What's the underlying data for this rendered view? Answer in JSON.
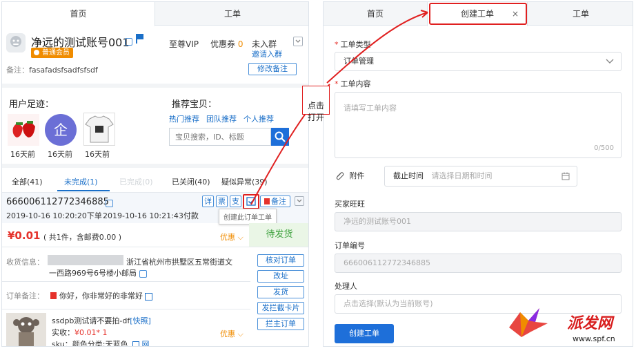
{
  "left": {
    "tabs": [
      "首页",
      "工单"
    ],
    "account": {
      "name": "净远的测试账号001",
      "level_badge": "普通会员",
      "vip": "至尊VIP",
      "coupon_label": "优惠券",
      "coupon_count": "0",
      "group_status": "未入群",
      "invite_link": "邀请入群",
      "note_label": "备注：",
      "note_value": "fasafadsfsadfsfsdf",
      "edit_note_button": "修改备注"
    },
    "footprint": {
      "title": "用户足迹：",
      "items": [
        {
          "time": "16天前",
          "icon": "strawberry-thumbnail"
        },
        {
          "time": "16天前",
          "icon": "enterprise-logo",
          "glyph": "企"
        },
        {
          "time": "16天前",
          "icon": "tshirt-thumbnail"
        }
      ]
    },
    "recommend": {
      "title": "推荐宝贝：",
      "links": [
        "热门推荐",
        "团队推荐",
        "个人推荐"
      ],
      "search_placeholder": "宝贝搜索，ID、标题"
    },
    "order_tabs": [
      "全部(41)",
      "未完成(1)",
      "已完成(0)",
      "已关闭(40)",
      "疑似异常(39)"
    ],
    "order": {
      "id": "666006112772346885",
      "placed_time": "2019-10-16 10:20:20下单",
      "paid_time": "2019-10-16 10:21:43付款",
      "action_buttons": [
        "详",
        "票",
        "支"
      ],
      "note_button": "备注",
      "tooltip": "创建此订单工单",
      "price": "¥0.01",
      "price_detail": "( 共1件，含邮费0.00 )",
      "discount": "优惠",
      "status": "待发货",
      "address_label": "收货信息：",
      "address_line1": "浙江省杭州市拱墅区五常街道文",
      "address_line2": "一西路969号6号楼小邮局",
      "order_note_label": "订单备注：",
      "order_note_value": "你好，你非常好的非常好",
      "side_buttons": [
        "核对订单",
        "改址",
        "发货",
        "发拦截卡片",
        "拦主订单"
      ],
      "product_title": "ssdpb测试请不要拍-df",
      "product_tag": "[快照]",
      "actual_label": "实收：",
      "actual_price": "¥0.01",
      "actual_qty": "* 1",
      "sku": "sku：颜色分类:天蓝色",
      "sku_tag": "网",
      "discount2": "优惠"
    }
  },
  "annotation": {
    "callout": "点击\n打开"
  },
  "right": {
    "tabs": [
      "首页",
      "创建工单",
      "工单"
    ],
    "close_glyph": "×",
    "form": {
      "type_label": "工单类型",
      "type_value": "订单管理",
      "content_label": "工单内容",
      "content_placeholder": "请填写工单内容",
      "content_counter": "0/500",
      "attach_label": "附件",
      "deadline_label": "截止时间",
      "deadline_placeholder": "请选择日期和时间",
      "buyer_label": "买家旺旺",
      "buyer_value": "净远的测试账号001",
      "order_label": "订单编号",
      "order_value": "666006112772346885",
      "handler_label": "处理人",
      "handler_placeholder": "点击选择(默认为当前账号)",
      "submit_button": "创建工单"
    }
  },
  "watermark": {
    "brand": "派发网",
    "url": "www.spf.cn"
  },
  "colors": {
    "accent": "#1a6fc8",
    "primary_button": "#1e6fd9",
    "red": "#e5322b",
    "orange": "#f08c00",
    "status_green": "#3aa03a",
    "annotation_red": "#e02020"
  }
}
